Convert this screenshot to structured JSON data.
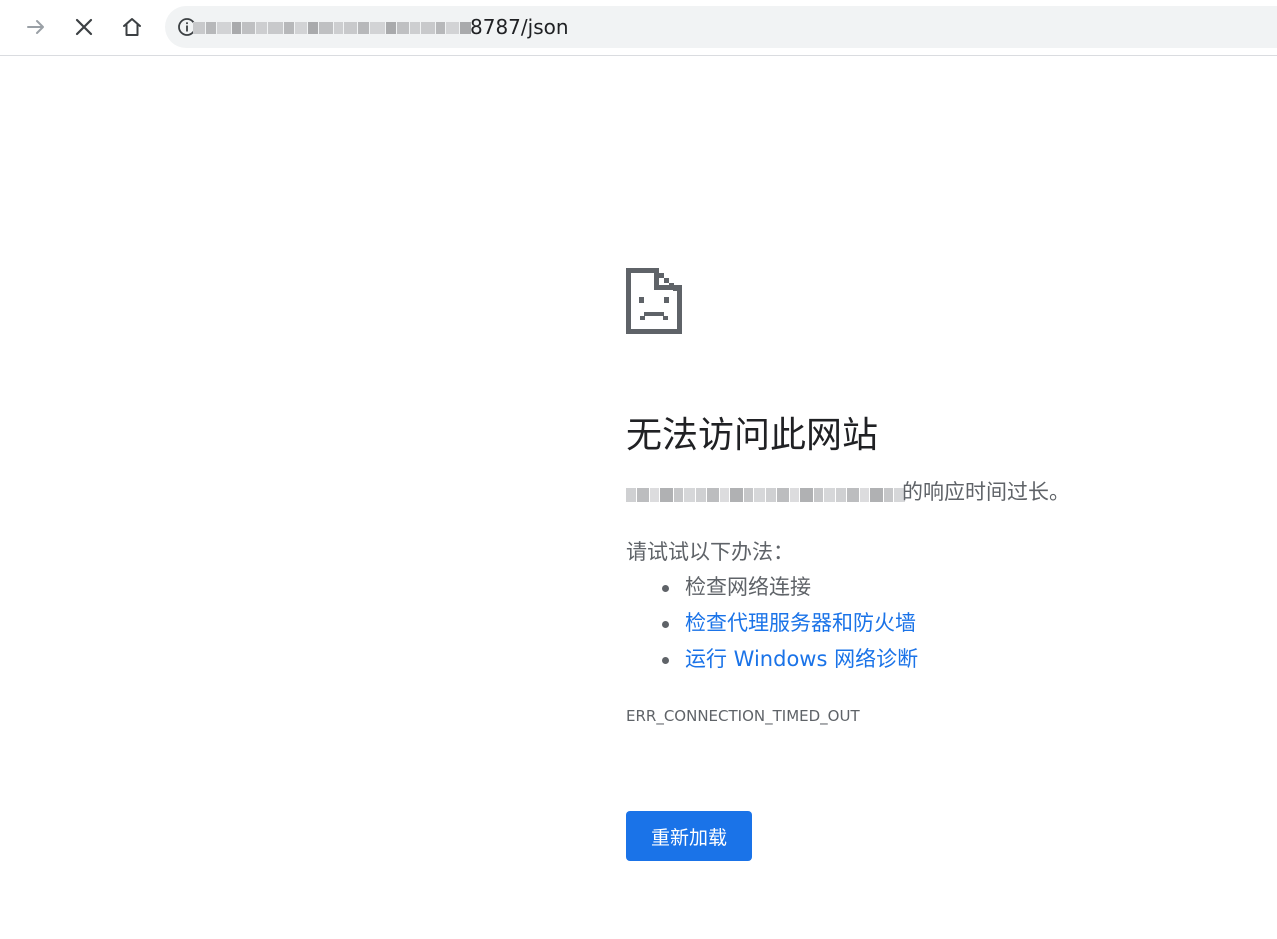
{
  "browser": {
    "address_bar": {
      "url_visible_suffix": "8787/json"
    },
    "icons": [
      "forward-arrow-icon",
      "stop-icon",
      "home-icon",
      "site-info-icon"
    ]
  },
  "error_page": {
    "icon": "sad-document-icon",
    "title": "无法访问此网站",
    "summary_suffix": "的响应时间过长。",
    "suggestions_intro": "请试试以下办法：",
    "suggestions": [
      {
        "label": "检查网络连接",
        "is_link": false
      },
      {
        "label": "检查代理服务器和防火墙",
        "is_link": true
      },
      {
        "label": "运行 Windows 网络诊断",
        "is_link": true
      }
    ],
    "error_code": "ERR_CONNECTION_TIMED_OUT",
    "reload_button": "重新加载"
  },
  "colors": {
    "accent": "#1a73e8",
    "secondary_text": "#5f6368",
    "primary_text": "#202124",
    "omnibox_bg": "#f1f3f4"
  }
}
